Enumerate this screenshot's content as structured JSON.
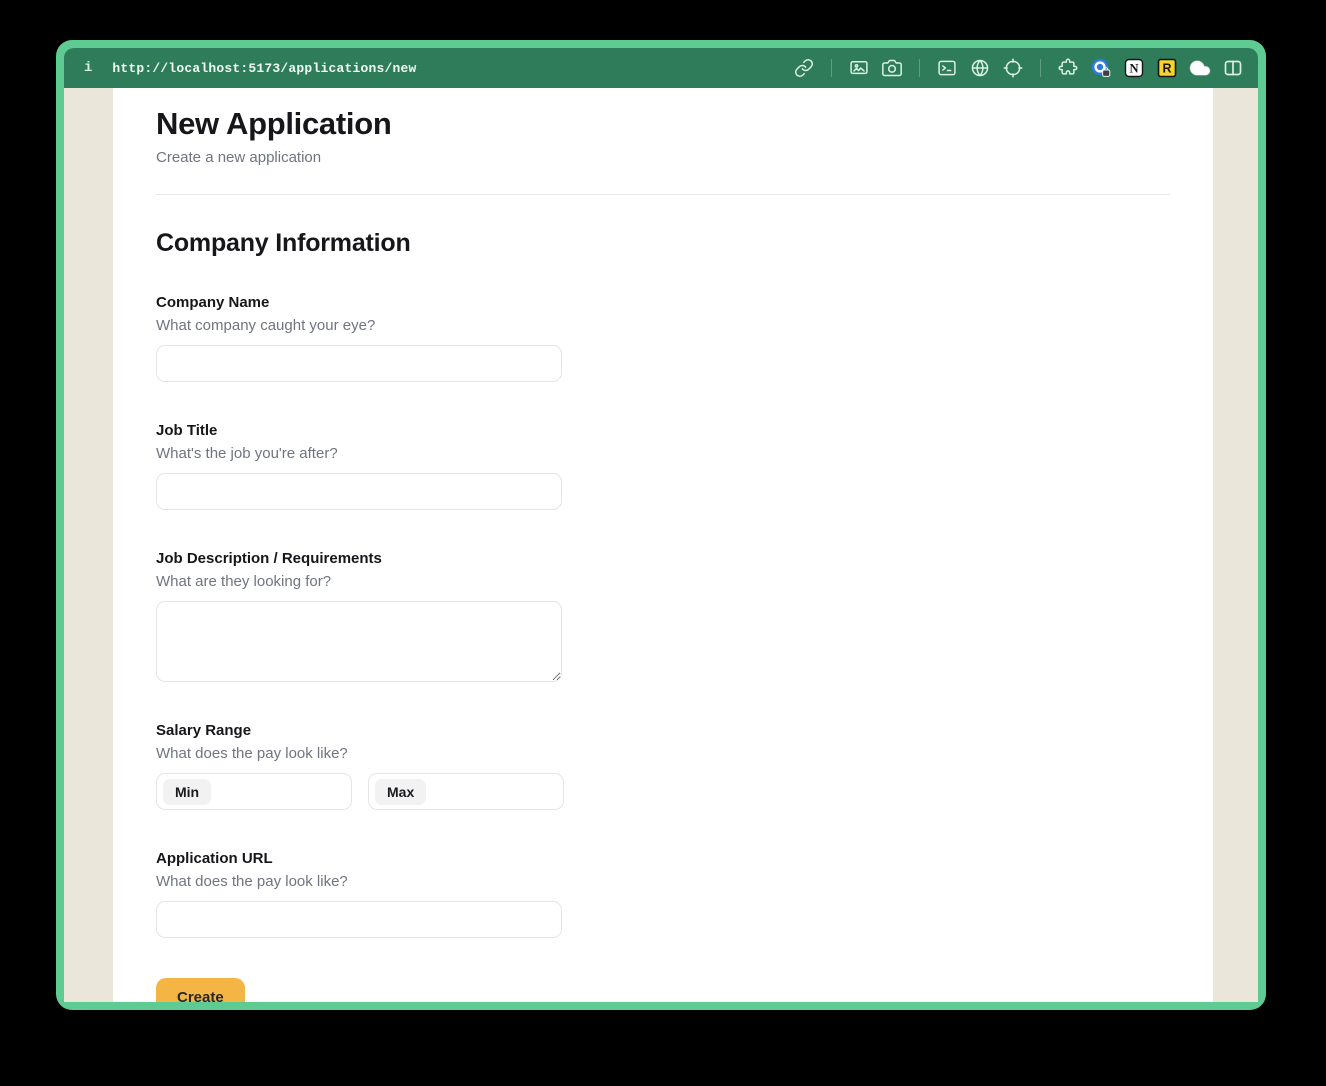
{
  "browser": {
    "info_glyph": "i",
    "url": "http://localhost:5173/applications/new",
    "toolbar_icons": [
      "link-icon",
      "screen-capture-icon",
      "camera-icon",
      "terminal-icon",
      "globe-icon",
      "crosshair-icon",
      "puzzle-extension-icon",
      "onepassword-icon",
      "notion-icon",
      "r-extension-icon",
      "cloud-icon",
      "split-view-icon"
    ]
  },
  "header": {
    "title": "New Application",
    "subtitle": "Create a new application"
  },
  "form": {
    "section_title": "Company Information",
    "fields": [
      {
        "label": "Company Name",
        "hint": "What company caught your eye?"
      },
      {
        "label": "Job Title",
        "hint": "What's the job you're after?"
      },
      {
        "label": "Job Description / Requirements",
        "hint": "What are they looking for?"
      },
      {
        "label": "Salary Range",
        "hint": "What does the pay look like?",
        "min_label": "Min",
        "max_label": "Max"
      },
      {
        "label": "Application URL",
        "hint": "What does the pay look like?"
      }
    ],
    "submit_label": "Create"
  },
  "colors": {
    "window_frame": "#5ecb93",
    "titlebar": "#2e7c59",
    "page_background": "#eae7da",
    "content_background": "#ffffff",
    "submit_button": "#f4b544",
    "onepassword_blue": "#2f7be0",
    "r_extension_yellow": "#f6d32d"
  }
}
